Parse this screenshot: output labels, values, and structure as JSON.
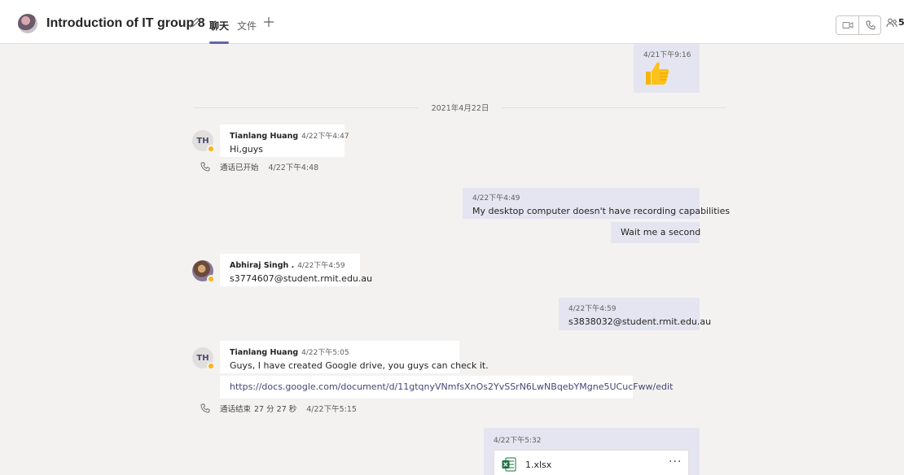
{
  "header": {
    "title": "Introduction of IT group 8",
    "tabs": [
      {
        "label": "聊天",
        "active": true
      },
      {
        "label": "文件",
        "active": false
      }
    ],
    "people_count": "5"
  },
  "date_divider": "2021年4月22日",
  "messages": {
    "m0": {
      "time": "4/21下午9:16",
      "emoji": "thumbs-up"
    },
    "m1": {
      "sender": "Tianlang Huang",
      "time": "4/22下午4:47",
      "text": "Hi,guys",
      "initials": "TH"
    },
    "sys1": {
      "label": "通话已开始",
      "time": "4/22下午4:48"
    },
    "m2": {
      "time": "4/22下午4:49",
      "text": "My desktop computer doesn't have recording capabilities"
    },
    "m3": {
      "text": "Wait me a second"
    },
    "m4": {
      "sender": "Abhiraj Singh .",
      "time": "4/22下午4:59",
      "text": "s3774607@student.rmit.edu.au"
    },
    "m5": {
      "time": "4/22下午4:59",
      "text": "s3838032@student.rmit.edu.au"
    },
    "m6": {
      "sender": "Tianlang Huang",
      "time": "4/22下午5:05",
      "text": "Guys, I have created Google drive, you guys can check it.",
      "initials": "TH"
    },
    "m7": {
      "link": "https://docs.google.com/document/d/11gtqnyVNmfsXnOs2YvSSrN6LwNBqebYMgne5UCucFww/edit"
    },
    "sys2": {
      "label": "通话结束",
      "duration": "27 分 27 秒",
      "time": "4/22下午5:15"
    },
    "m8": {
      "time": "4/22下午5:32",
      "file_name": "1.xlsx",
      "more": "···"
    }
  },
  "colors": {
    "accent": "#6264a7",
    "self_bubble": "#e5e5f1",
    "presence_away": "#fcb415",
    "excel": "#1d6f42"
  }
}
